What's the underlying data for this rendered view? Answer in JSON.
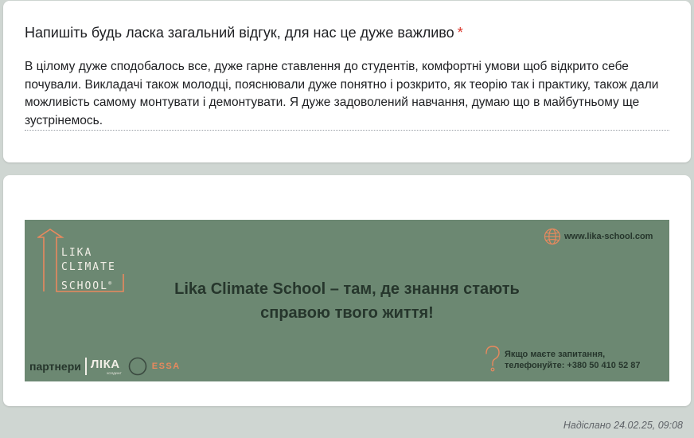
{
  "question": {
    "title": "Напишіть будь ласка загальний відгук, для нас це дуже важливо",
    "required_marker": "*",
    "answer": "В цілому дуже сподобалось все, дуже гарне ставлення до студентів, комфортні умови щоб відкрито себе почували. Викладачі також молодці, пояснювали дуже понятно і розкрито, як теорію так і практику, також дали можливість самому монтувати і демонтувати. Я дуже задоволений навчання, думаю що в майбутньому ще зустрінемось."
  },
  "banner": {
    "logo_lines": [
      "LIKA",
      "CLIMATE",
      "SCHOOL"
    ],
    "logo_mark": "®",
    "website": "www.lika-school.com",
    "headline": "Lika Climate School – там, де знання стають справою твого життя!",
    "partners_label": "партнери",
    "partner_lika": "ЛІКА",
    "partner_lika_sub": "ХОЛДИНГ",
    "partner_essa": "ESSA",
    "contact_line_1": "Якщо маєте запитання,",
    "contact_line_2": "телефонуйте: +380 50 410 52 87",
    "colors": {
      "background": "#6c8872",
      "accent": "#e8895e",
      "text_dark": "#26362c",
      "text_light": "#f2efe7"
    },
    "icons": [
      "arrow-up-outline-icon",
      "globe-icon",
      "ring-icon",
      "question-mark-icon"
    ]
  },
  "footer": {
    "submitted": "Надіслано 24.02.25, 09:08"
  }
}
